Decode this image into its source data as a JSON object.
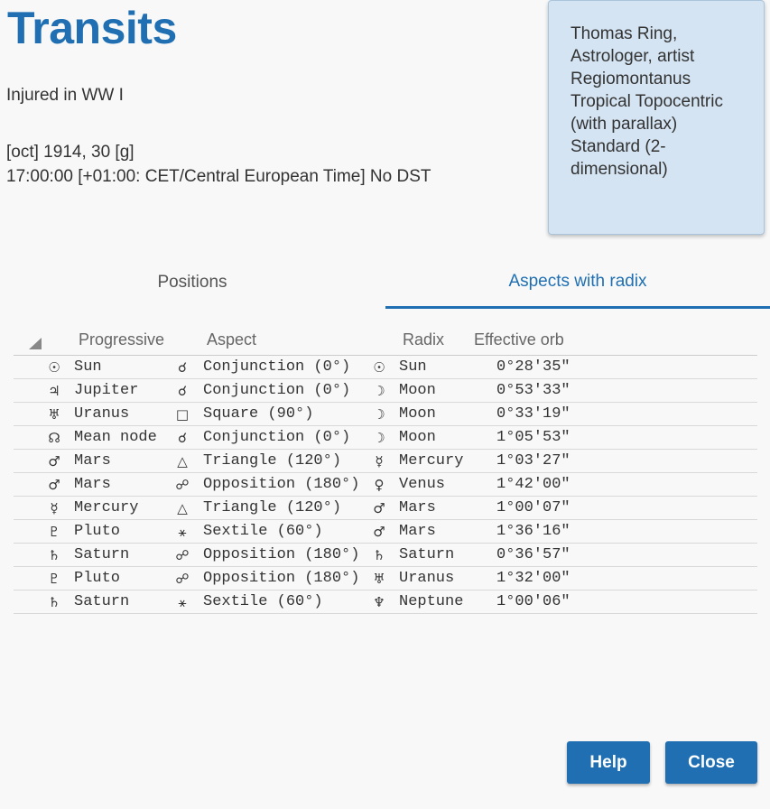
{
  "title": "Transits",
  "event": "Injured in WW I",
  "date_line": "[oct] 1914, 30 [g]",
  "time_line": "17:00:00 [+01:00: CET/Central European Time] No DST",
  "infobox": {
    "lines": [
      "Thomas Ring,",
      "Astrologer, artist",
      "Regiomontanus",
      "Tropical Topocentric",
      "(with parallax)",
      "Standard (2-",
      "dimensional)"
    ]
  },
  "tabs": {
    "positions": "Positions",
    "aspects": "Aspects with radix"
  },
  "table": {
    "headers": {
      "progressive": "Progressive",
      "aspect": "Aspect",
      "radix": "Radix",
      "orb": "Effective orb"
    },
    "rows": [
      {
        "pg": "☉",
        "progressive": "Sun",
        "ag": "☌",
        "aspect": "Conjunction (0°)",
        "rg": "☉",
        "radix": "Sun",
        "orb": "0°28′35″",
        "pg_icon": "sun-icon",
        "ag_icon": "conjunction-icon",
        "rg_icon": "sun-icon"
      },
      {
        "pg": "♃",
        "progressive": "Jupiter",
        "ag": "☌",
        "aspect": "Conjunction (0°)",
        "rg": "☽",
        "radix": "Moon",
        "orb": "0°53′33″",
        "pg_icon": "jupiter-icon",
        "ag_icon": "conjunction-icon",
        "rg_icon": "moon-icon"
      },
      {
        "pg": "♅",
        "progressive": "Uranus",
        "ag": "□",
        "aspect": "Square (90°)",
        "rg": "☽",
        "radix": "Moon",
        "orb": "0°33′19″",
        "pg_icon": "uranus-icon",
        "ag_icon": "square-icon",
        "rg_icon": "moon-icon"
      },
      {
        "pg": "☊",
        "progressive": "Mean node",
        "ag": "☌",
        "aspect": "Conjunction (0°)",
        "rg": "☽",
        "radix": "Moon",
        "orb": "1°05′53″",
        "pg_icon": "node-icon",
        "ag_icon": "conjunction-icon",
        "rg_icon": "moon-icon"
      },
      {
        "pg": "♂",
        "progressive": "Mars",
        "ag": "△",
        "aspect": "Triangle (120°)",
        "rg": "☿",
        "radix": "Mercury",
        "orb": "1°03′27″",
        "pg_icon": "mars-icon",
        "ag_icon": "trine-icon",
        "rg_icon": "mercury-icon"
      },
      {
        "pg": "♂",
        "progressive": "Mars",
        "ag": "☍",
        "aspect": "Opposition (180°)",
        "rg": "♀",
        "radix": "Venus",
        "orb": "1°42′00″",
        "pg_icon": "mars-icon",
        "ag_icon": "opposition-icon",
        "rg_icon": "venus-icon"
      },
      {
        "pg": "☿",
        "progressive": "Mercury",
        "ag": "△",
        "aspect": "Triangle (120°)",
        "rg": "♂",
        "radix": "Mars",
        "orb": "1°00′07″",
        "pg_icon": "mercury-icon",
        "ag_icon": "trine-icon",
        "rg_icon": "mars-icon"
      },
      {
        "pg": "♇",
        "progressive": "Pluto",
        "ag": "⚹",
        "aspect": "Sextile (60°)",
        "rg": "♂",
        "radix": "Mars",
        "orb": "1°36′16″",
        "pg_icon": "pluto-icon",
        "ag_icon": "sextile-icon",
        "rg_icon": "mars-icon"
      },
      {
        "pg": "♄",
        "progressive": "Saturn",
        "ag": "☍",
        "aspect": "Opposition (180°)",
        "rg": "♄",
        "radix": "Saturn",
        "orb": "0°36′57″",
        "pg_icon": "saturn-icon",
        "ag_icon": "opposition-icon",
        "rg_icon": "saturn-icon"
      },
      {
        "pg": "♇",
        "progressive": "Pluto",
        "ag": "☍",
        "aspect": "Opposition (180°)",
        "rg": "♅",
        "radix": "Uranus",
        "orb": "1°32′00″",
        "pg_icon": "pluto-icon",
        "ag_icon": "opposition-icon",
        "rg_icon": "uranus-icon"
      },
      {
        "pg": "♄",
        "progressive": "Saturn",
        "ag": "⚹",
        "aspect": "Sextile (60°)",
        "rg": "♆",
        "radix": "Neptune",
        "orb": "1°00′06″",
        "pg_icon": "saturn-icon",
        "ag_icon": "sextile-icon",
        "rg_icon": "neptune-icon"
      }
    ]
  },
  "buttons": {
    "help": "Help",
    "close": "Close"
  },
  "colors": {
    "accent": "#1f6fb2",
    "infobox_bg": "#d4e4f2"
  }
}
